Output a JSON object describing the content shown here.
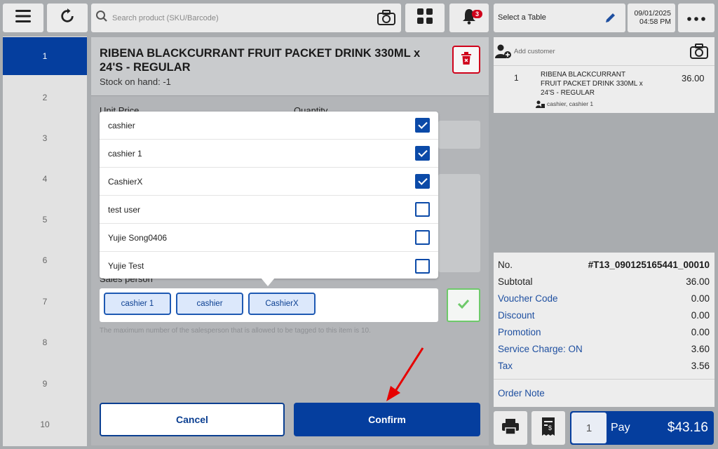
{
  "topbar": {
    "search_placeholder": "Search product (SKU/Barcode)",
    "notification_count": "3",
    "table_label": "Select a Table",
    "date": "09/01/2025",
    "time": "04:58 PM"
  },
  "sidebar": {
    "items": [
      "1",
      "2",
      "3",
      "4",
      "5",
      "6",
      "7",
      "8",
      "9",
      "10"
    ],
    "active_index": 0
  },
  "item_modal": {
    "product_title": "RIBENA BLACKCURRANT FRUIT PACKET DRINK 330ML x 24'S - REGULAR",
    "stock": "Stock on hand: -1",
    "unit_price_label": "Unit Price",
    "quantity_label": "Quantity",
    "salesperson_label": "Sales person",
    "salesperson_options": [
      {
        "name": "cashier",
        "checked": true
      },
      {
        "name": "cashier 1",
        "checked": true
      },
      {
        "name": "CashierX",
        "checked": true
      },
      {
        "name": "test user",
        "checked": false
      },
      {
        "name": "Yujie Song0406",
        "checked": false
      },
      {
        "name": "Yujie Test",
        "checked": false
      }
    ],
    "selected_tags": [
      "cashier 1",
      "cashier",
      "CashierX"
    ],
    "max_note": "The maximum number of the salesperson that is allowed to be tagged to this item is 10.",
    "cancel_label": "Cancel",
    "confirm_label": "Confirm"
  },
  "order_panel": {
    "add_customer": "Add customer",
    "line": {
      "qty": "1",
      "name": "RIBENA BLACKCURRANT FRUIT PACKET DRINK 330ML x 24'S - REGULAR",
      "price": "36.00",
      "salespersons": "cashier, cashier 1"
    }
  },
  "summary": {
    "no_label": "No.",
    "no_value": "#T13_090125165441_00010",
    "subtotal_label": "Subtotal",
    "subtotal_value": "36.00",
    "voucher_label": "Voucher Code",
    "voucher_value": "0.00",
    "discount_label": "Discount",
    "discount_value": "0.00",
    "promotion_label": "Promotion",
    "promotion_value": "0.00",
    "service_label": "Service Charge: ON",
    "service_value": "3.60",
    "tax_label": "Tax",
    "tax_value": "3.56",
    "order_note": "Order Note"
  },
  "payment": {
    "qty": "1",
    "pay_label": "Pay",
    "total": "$43.16"
  },
  "colors": {
    "primary": "#053e9e",
    "badge": "#d0021b",
    "success": "#6ec96a",
    "delete": "#d0021b"
  }
}
